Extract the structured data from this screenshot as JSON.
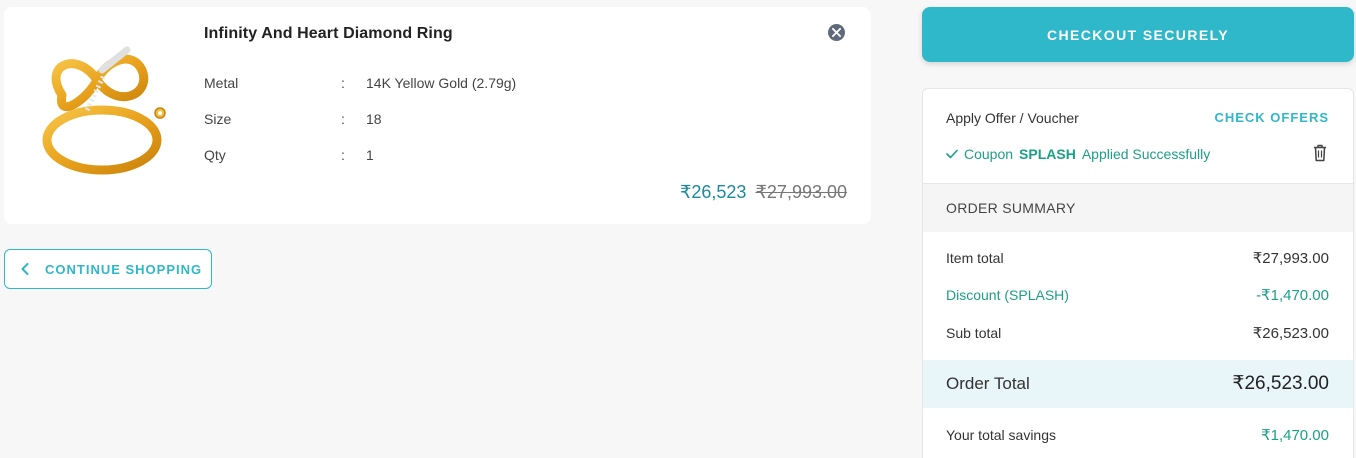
{
  "product": {
    "title": "Infinity And Heart Diamond Ring",
    "attributes": [
      {
        "label": "Metal",
        "sep": ":",
        "value": "14K Yellow Gold (2.79g)"
      },
      {
        "label": "Size",
        "sep": ":",
        "value": "18"
      },
      {
        "label": "Qty",
        "sep": ":",
        "value": "1"
      }
    ],
    "price": "₹26,523",
    "original_price": "₹27,993.00"
  },
  "continue_shopping_label": "CONTINUE SHOPPING",
  "checkout_label": "CHECKOUT SECURELY",
  "offer": {
    "label": "Apply Offer / Voucher",
    "check_offers_label": "CHECK OFFERS",
    "coupon_prefix": "Coupon",
    "coupon_code": "SPLASH",
    "coupon_suffix": "Applied Successfully"
  },
  "summary": {
    "heading": "ORDER SUMMARY",
    "rows": [
      {
        "label": "Item total",
        "value": "₹27,993.00"
      },
      {
        "label": "Discount (SPLASH)",
        "value": "-₹1,470.00"
      },
      {
        "label": "Sub total",
        "value": "₹26,523.00"
      }
    ],
    "order_total_label": "Order Total",
    "order_total_value": "₹26,523.00",
    "savings_label": "Your total savings",
    "savings_value": "₹1,470.00"
  },
  "colors": {
    "accent": "#2eb8c9",
    "success": "#1ca085",
    "price": "#1b8a9e"
  },
  "icons": [
    "ring-product-image",
    "close-icon",
    "chevron-left-icon",
    "check-icon",
    "trash-icon"
  ]
}
